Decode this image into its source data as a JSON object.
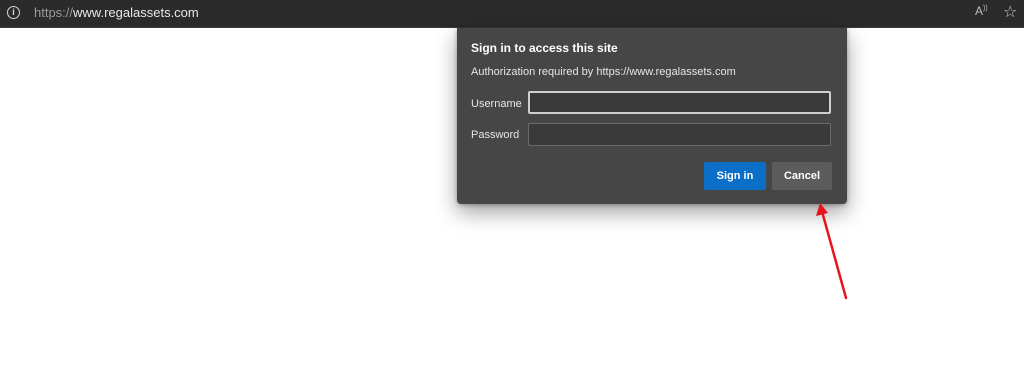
{
  "browser": {
    "url_scheme": "https://",
    "url_host": "www.regalassets.com",
    "info_icon": "i",
    "read_aloud_icon": "A",
    "read_aloud_sup": "))",
    "favorite_icon": "☆"
  },
  "dialog": {
    "title": "Sign in to access this site",
    "subtitle": "Authorization required by https://www.regalassets.com",
    "username_label": "Username",
    "password_label": "Password",
    "username_value": "",
    "password_value": "",
    "signin_label": "Sign in",
    "cancel_label": "Cancel",
    "signin_color": "#0b6fc7"
  },
  "annotation": {
    "arrow_color": "#e8141c"
  }
}
